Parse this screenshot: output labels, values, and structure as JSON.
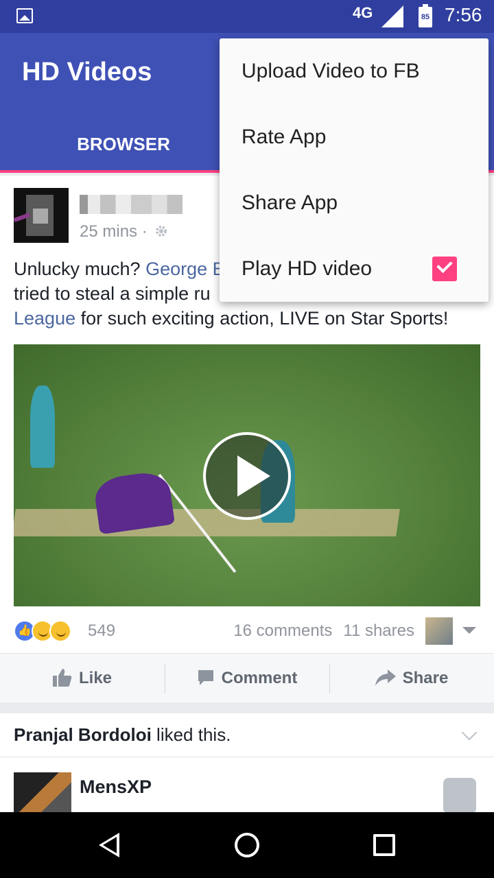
{
  "status_bar": {
    "network": "4G",
    "battery": "85",
    "time": "7:56"
  },
  "app_bar": {
    "title": "HD Videos",
    "tabs": [
      {
        "label": "BROWSER"
      }
    ]
  },
  "post": {
    "time": "25 mins ·",
    "text_prefix": "Unlucky much? ",
    "text_link_1": "George B",
    "text_middle": "tried to steal a simple ru",
    "text_link_2": "League",
    "text_suffix": " for such exciting action, LIVE on Star Sports!",
    "reaction_count": "549",
    "comments": "16 comments",
    "shares": "11 shares",
    "actions": {
      "like": "Like",
      "comment": "Comment",
      "share": "Share"
    }
  },
  "liked_banner": {
    "name": "Pranjal Bordoloi",
    "suffix": " liked this."
  },
  "next_post": {
    "name": "MensXP"
  },
  "menu": {
    "items": [
      {
        "label": "Upload Video to FB"
      },
      {
        "label": "Rate App"
      },
      {
        "label": "Share App"
      },
      {
        "label": "Play HD video",
        "checked": true
      }
    ]
  },
  "colors": {
    "primary": "#3f51b5",
    "primary_dark": "#303f9f",
    "accent": "#ff4081",
    "link": "#4b67a1"
  }
}
